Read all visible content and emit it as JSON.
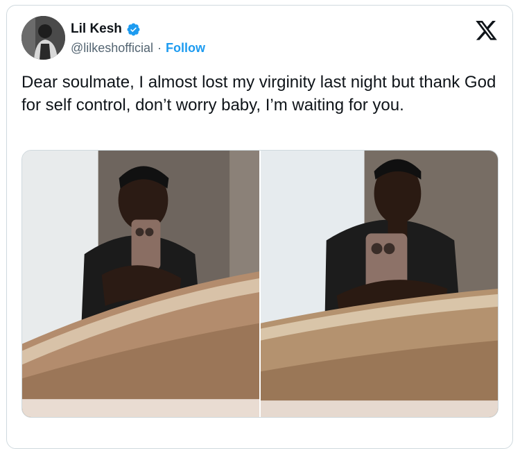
{
  "tweet": {
    "author_name": "Lil Kesh",
    "handle": "@lilkeshofficial",
    "separator": "·",
    "follow_label": "Follow",
    "text": "Dear soulmate, I almost lost my virginity last night but thank God for self control, don’t worry baby, I’m waiting for you."
  },
  "icons": {
    "verified": "verified-badge-icon",
    "brand": "x-logo-icon"
  },
  "colors": {
    "accent": "#1d9bf0",
    "text": "#0f1419",
    "muted": "#536471",
    "border": "#cfd9de"
  }
}
